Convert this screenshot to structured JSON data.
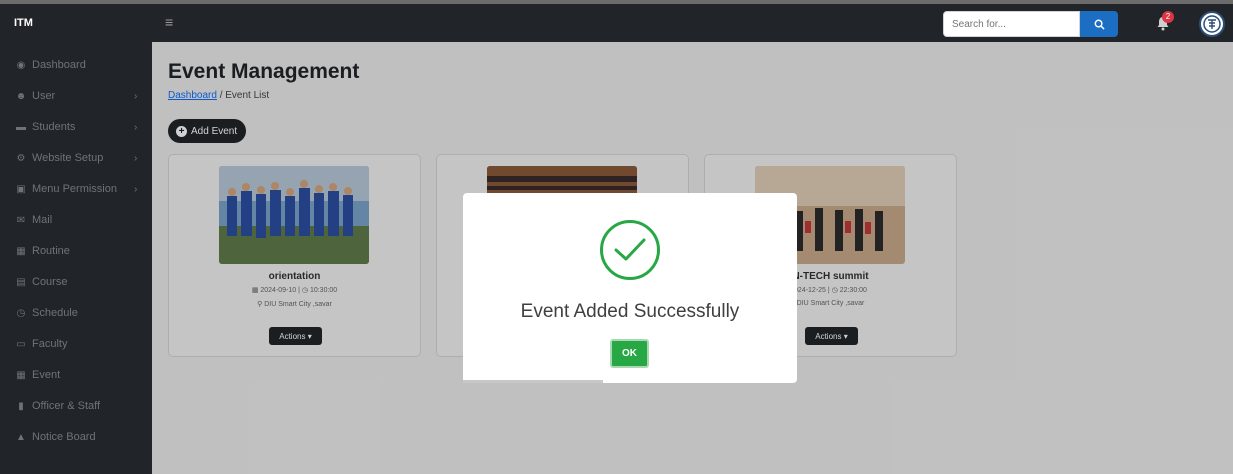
{
  "topbar": {
    "brand": "ITM",
    "search_placeholder": "Search for...",
    "notification_count": "2",
    "avatar_text": "ঢাবি"
  },
  "sidebar": {
    "items": [
      {
        "label": "Dashboard",
        "icon": "dashboard-icon",
        "glyph": "◉",
        "has_chevron": false
      },
      {
        "label": "User",
        "icon": "users-icon",
        "glyph": "☻",
        "has_chevron": true
      },
      {
        "label": "Students",
        "icon": "students-icon",
        "glyph": "▬",
        "has_chevron": true
      },
      {
        "label": "Website Setup",
        "icon": "website-setup-icon",
        "glyph": "⚙",
        "has_chevron": true
      },
      {
        "label": "Menu Permission",
        "icon": "menu-permission-icon",
        "glyph": "▣",
        "has_chevron": true
      },
      {
        "label": "Mail",
        "icon": "mail-icon",
        "glyph": "✉",
        "has_chevron": false
      },
      {
        "label": "Routine",
        "icon": "routine-icon",
        "glyph": "▦",
        "has_chevron": false
      },
      {
        "label": "Course",
        "icon": "course-icon",
        "glyph": "▤",
        "has_chevron": false
      },
      {
        "label": "Schedule",
        "icon": "schedule-icon",
        "glyph": "◷",
        "has_chevron": false
      },
      {
        "label": "Faculty",
        "icon": "faculty-icon",
        "glyph": "▭",
        "has_chevron": false
      },
      {
        "label": "Event",
        "icon": "event-icon",
        "glyph": "▦",
        "has_chevron": false
      },
      {
        "label": "Officer & Staff",
        "icon": "officer-staff-icon",
        "glyph": "▮",
        "has_chevron": false
      },
      {
        "label": "Notice Board",
        "icon": "notice-board-icon",
        "glyph": "▲",
        "has_chevron": false
      }
    ]
  },
  "main": {
    "title": "Event Management",
    "breadcrumb_link": "Dashboard",
    "breadcrumb_sep": " / ",
    "breadcrumb_current": "Event List",
    "add_button": "Add Event"
  },
  "cards": [
    {
      "title": "orientation",
      "datetime": "▦ 2024-09-10 | ◷ 10:30:00",
      "location": "⚲ DIU Smart City ,savar",
      "actions": "Actions ▾"
    },
    {
      "title": "",
      "datetime": "",
      "location": "",
      "actions": ""
    },
    {
      "title": "N-TECH summit",
      "datetime": "024-12-25 | ◷ 22:30:00",
      "location": "DIU Smart City ,savar",
      "actions": "Actions ▾"
    }
  ],
  "modal": {
    "title": "Event Added Successfully",
    "ok_label": "OK",
    "success_color": "#28a745"
  }
}
